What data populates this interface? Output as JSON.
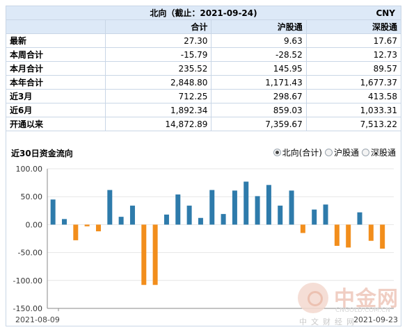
{
  "header": {
    "title": "北向（截止：2021-09-24)",
    "currency": "CNY"
  },
  "table": {
    "columns": [
      "合计",
      "沪股通",
      "深股通"
    ],
    "rows": [
      {
        "label": "最新",
        "values": [
          "27.30",
          "9.63",
          "17.67"
        ]
      },
      {
        "label": "本周合计",
        "values": [
          "-15.79",
          "-28.52",
          "12.73"
        ]
      },
      {
        "label": "本月合计",
        "values": [
          "235.52",
          "145.95",
          "89.57"
        ]
      },
      {
        "label": "本年合计",
        "values": [
          "2,848.80",
          "1,171.43",
          "1,677.37"
        ]
      },
      {
        "label": "近3月",
        "values": [
          "712.25",
          "298.67",
          "413.58"
        ]
      },
      {
        "label": "近6月",
        "values": [
          "1,892.34",
          "859.03",
          "1,033.31"
        ]
      },
      {
        "label": "开通以来",
        "values": [
          "14,872.89",
          "7,359.67",
          "7,513.22"
        ]
      }
    ]
  },
  "chart_panel": {
    "title": "近30日资金流向",
    "options": [
      {
        "label": "北向(合计)",
        "selected": true
      },
      {
        "label": "沪股通",
        "selected": false
      },
      {
        "label": "深股通",
        "selected": false
      }
    ]
  },
  "watermark": {
    "brand": "中金网",
    "url": "CNGOLD.COM.CN",
    "sub": "中文财经网"
  },
  "chart_data": {
    "type": "bar",
    "ylim": [
      -150,
      100
    ],
    "yticks": [
      100,
      50,
      0,
      -50,
      -100,
      -150
    ],
    "ytick_labels": [
      "100.00",
      "50.00",
      "0.00",
      "-50.00",
      "-100.00",
      "-150.00"
    ],
    "x_labels": [
      "2021-08-09",
      "2021-09-23"
    ],
    "colors": {
      "positive": "#2e7bab",
      "negative": "#f28e1c"
    },
    "values": [
      45,
      10,
      -28,
      -3,
      -12,
      62,
      14,
      34,
      -108,
      -108,
      18,
      54,
      34,
      12,
      62,
      19,
      61,
      77,
      51,
      71,
      34,
      61,
      -15,
      27,
      36,
      -38,
      -41,
      22,
      -29,
      -43
    ]
  }
}
